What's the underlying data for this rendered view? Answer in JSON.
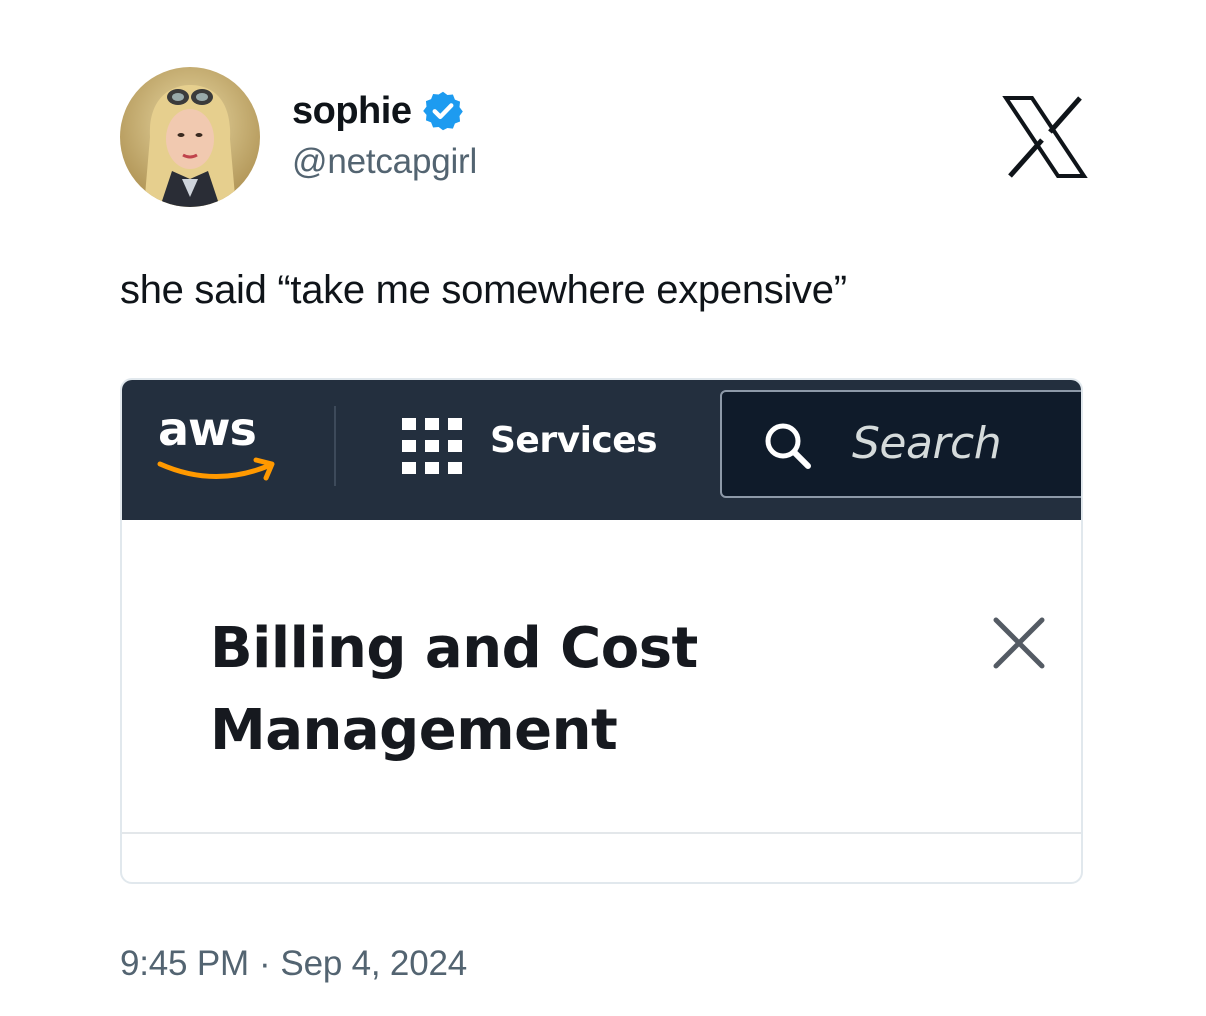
{
  "tweet": {
    "author": {
      "display_name": "sophie",
      "handle": "@netcapgirl",
      "verified": true,
      "avatar_icon": "user-avatar"
    },
    "platform_icon": "x-logo-icon",
    "text": "she said “take me somewhere expensive”",
    "time": "9:45 PM",
    "separator": "·",
    "date": "Sep 4, 2024"
  },
  "embedded_screenshot": {
    "nav": {
      "logo_text": "aws",
      "services_label": "Services",
      "search_placeholder": "Search"
    },
    "panel": {
      "title": "Billing and Cost Management",
      "close_icon": "close-icon"
    }
  },
  "colors": {
    "aws_nav_bg": "#232f3e",
    "aws_smile": "#ff9900",
    "verified_badge": "#1d9bf0",
    "muted_text": "#536471"
  }
}
